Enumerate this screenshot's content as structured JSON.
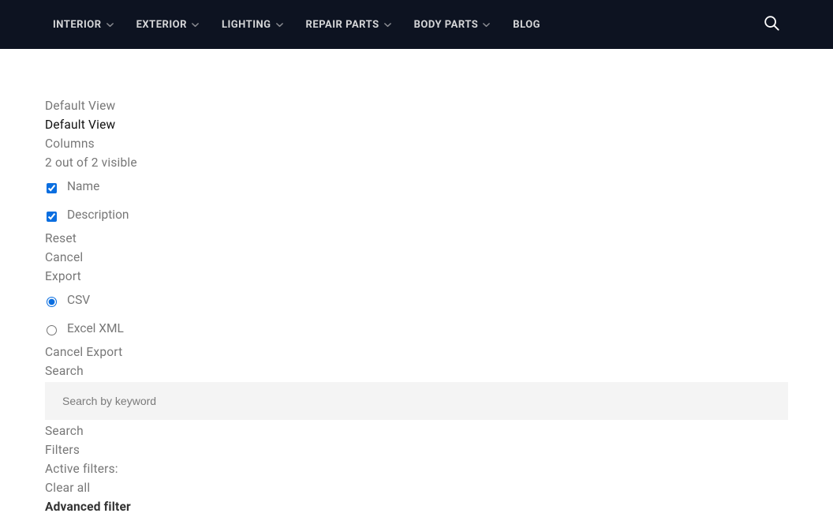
{
  "nav": {
    "items": [
      {
        "label": "INTERIOR",
        "hasDropdown": true
      },
      {
        "label": "EXTERIOR",
        "hasDropdown": true
      },
      {
        "label": "LIGHTING",
        "hasDropdown": true
      },
      {
        "label": "REPAIR PARTS",
        "hasDropdown": true
      },
      {
        "label": "BODY PARTS",
        "hasDropdown": true
      },
      {
        "label": "BLOG",
        "hasDropdown": false
      }
    ]
  },
  "view": {
    "default_label": "Default View",
    "default_selected": "Default View",
    "columns_label": "Columns",
    "columns_status": "2 out of 2 visible",
    "columns": [
      {
        "label": "Name",
        "checked": true
      },
      {
        "label": "Description",
        "checked": true
      }
    ],
    "reset": "Reset",
    "cancel": "Cancel",
    "export_label": "Export",
    "export_options": [
      {
        "label": "CSV",
        "selected": true
      },
      {
        "label": "Excel XML",
        "selected": false
      }
    ],
    "cancel_export": "Cancel Export",
    "search_label": "Search",
    "search_placeholder": "Search by keyword",
    "search_action": "Search",
    "filters_label": "Filters",
    "active_filters": "Active filters:",
    "clear_all": "Clear all",
    "advanced_filter": "Advanced filter"
  }
}
